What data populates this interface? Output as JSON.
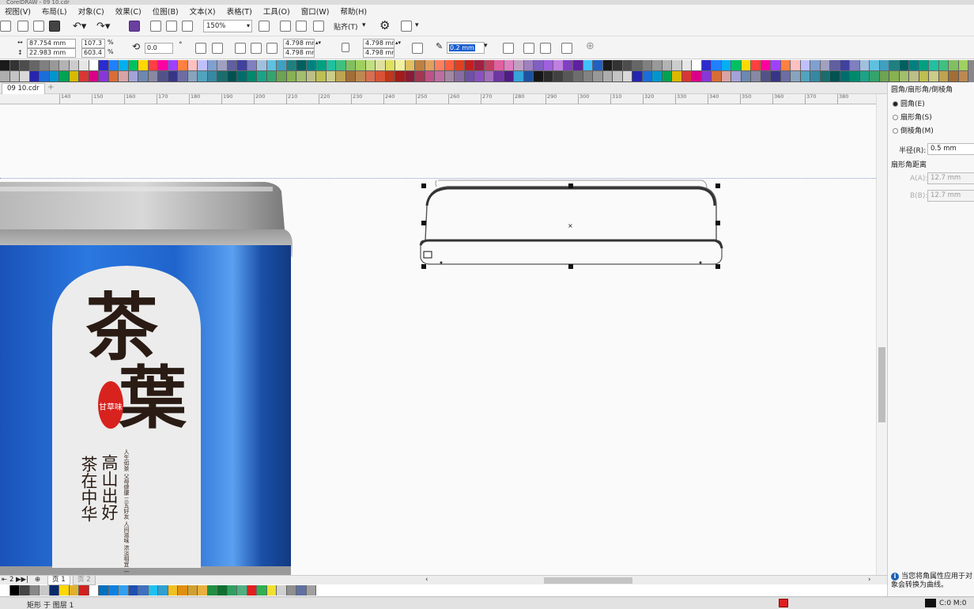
{
  "window": {
    "title": "CorelDRAW - 09 10.cdr"
  },
  "menu": [
    "视图(V)",
    "布局(L)",
    "对象(C)",
    "效果(C)",
    "位图(B)",
    "文本(X)",
    "表格(T)",
    "工具(O)",
    "窗口(W)",
    "帮助(H)"
  ],
  "toolbar": {
    "zoom": "150%",
    "snap_label": "贴齐(T)"
  },
  "property_bar": {
    "width": "87.754 mm",
    "height": "22.983 mm",
    "scale_x": "107.3",
    "scale_y": "603.4",
    "percent": "%",
    "rotation": "0.0",
    "degree": "°",
    "corner_tl": "4.798 mm",
    "corner_bl": "4.798 mm",
    "corner_tr": "4.798 mm",
    "corner_br": "4.798 mm",
    "outline_width": "0.2 mm"
  },
  "document_tab": "09 10.cdr",
  "ruler_ticks": [
    "140",
    "150",
    "160",
    "170",
    "180",
    "190",
    "200",
    "210",
    "220",
    "230",
    "240",
    "250",
    "260",
    "270",
    "280",
    "290",
    "300",
    "310",
    "320",
    "330",
    "340",
    "350",
    "360",
    "370",
    "380"
  ],
  "panel": {
    "title": "圆角/扇形角/倒棱角",
    "options": [
      "圆角(E)",
      "扇形角(S)",
      "倒棱角(M)"
    ],
    "selected_option": 0,
    "radius_label": "半径(R):",
    "radius_value": "0.5 mm",
    "distance_heading": "扇形角距离",
    "a_label": "A(A):",
    "a_value": "12.7 mm",
    "b_label": "B(B):",
    "b_value": "12.7 mm",
    "note": "当您将角属性应用于对象会转换为曲线。"
  },
  "pages": {
    "nav": "2",
    "page1": "页 1",
    "page2": "页 2"
  },
  "tea_label": {
    "big1": "茶",
    "big2": "葉",
    "seal": "甘草味",
    "col1": "茶在中华",
    "col2": "高山出好",
    "small_text": "人生如茶 父母健康 三五好友 人间滋味 浓淡相宜 一杯清茶 品味人生"
  },
  "status": {
    "layer": "矩形 于 图层 1",
    "fill": "C:0 M:0"
  },
  "palette_colors": [
    "#1a1a1a",
    "#333333",
    "#4d4d4d",
    "#666666",
    "#808080",
    "#999999",
    "#b3b3b3",
    "#cccccc",
    "#e6e6e6",
    "#ffffff",
    "#2b2bd0",
    "#2080ff",
    "#00b0f0",
    "#00c060",
    "#ffd800",
    "#ff4040",
    "#ff00a0",
    "#a040ff",
    "#ff8040",
    "#ffc0c0",
    "#c0c0ff",
    "#80a0d0",
    "#a0a0c0",
    "#6060a0",
    "#4040a0",
    "#8080c0",
    "#a0c0e0",
    "#60c0e0",
    "#40a0c0",
    "#208080",
    "#006060",
    "#008080",
    "#00a080",
    "#20c0a0",
    "#40c080",
    "#80c060",
    "#a0d060",
    "#c0e080",
    "#e0e0a0",
    "#e0e060",
    "#f0f0a0",
    "#e0c060",
    "#c08040",
    "#e0a060",
    "#ff8060",
    "#ff6040",
    "#e04020",
    "#c02020",
    "#a02040",
    "#c04060",
    "#e060a0",
    "#e080c0",
    "#c0a0c0",
    "#a080c0",
    "#8060c0",
    "#a060e0",
    "#c080e0",
    "#8040c0",
    "#6020a0",
    "#40c0ff",
    "#2060c0"
  ],
  "bottom_palette": [
    "#ffffff",
    "#000000",
    "#444444",
    "#888888",
    "#c8c8c8",
    "#0a2a6a",
    "#ffd800",
    "#e0b030",
    "#d02020",
    "#ffffff",
    "#0070c0",
    "#1080e0",
    "#30a0f0",
    "#2050b0",
    "#4070c0",
    "#20c0f0",
    "#30a0d0",
    "#f0c020",
    "#e09010",
    "#d0a030",
    "#e8b040",
    "#209040",
    "#107030",
    "#30a060",
    "#50b080",
    "#e02020",
    "#30b050",
    "#f0e030",
    "#d0d0d0",
    "#909090",
    "#6070a0",
    "#a0a0a0"
  ]
}
